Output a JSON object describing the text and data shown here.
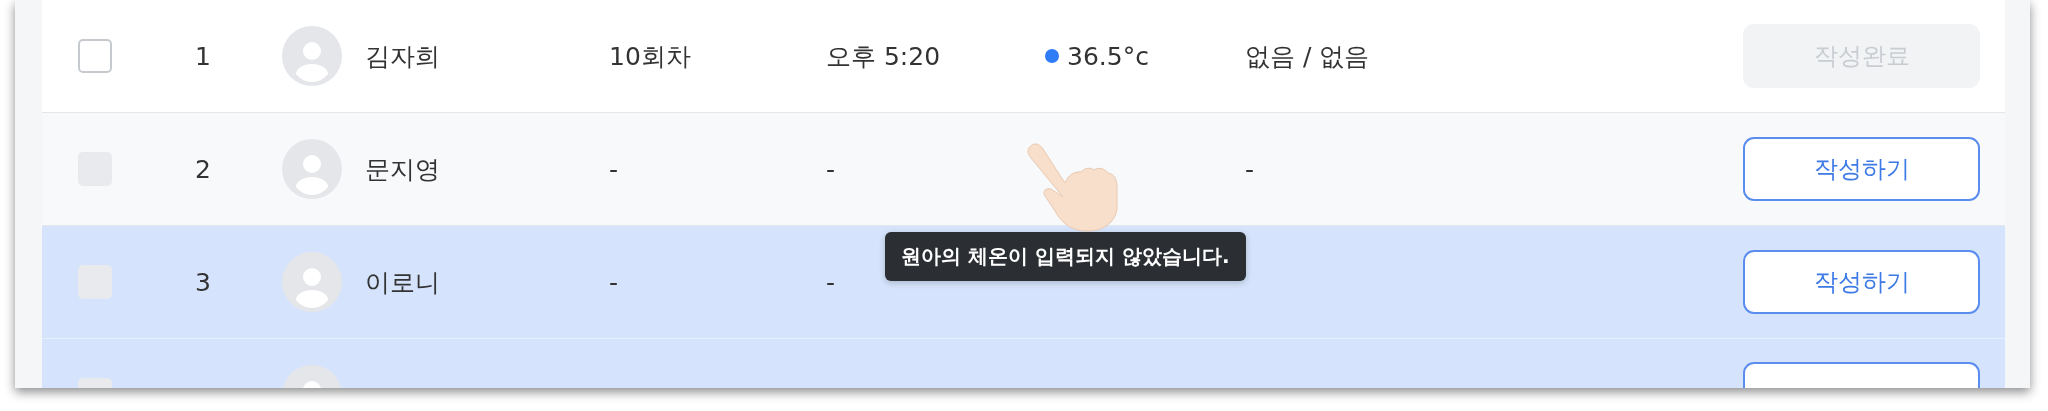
{
  "rows": [
    {
      "selected": false,
      "checkbox": {
        "checked": false,
        "disabled": false
      },
      "number": "1",
      "name": "김자희",
      "session": "10회차",
      "time": "오후 5:20",
      "temperature": {
        "text": "36.5°c",
        "color": "#2f7cf6"
      },
      "allergy": "없음 / 없음",
      "action": {
        "label": "작성완료",
        "disabled": true
      }
    },
    {
      "selected": false,
      "checkbox": {
        "checked": false,
        "disabled": true
      },
      "number": "2",
      "name": "문지영",
      "session": "-",
      "time": "-",
      "allergy": "-",
      "action": {
        "label": "작성하기",
        "disabled": false
      }
    },
    {
      "selected": true,
      "checkbox": {
        "checked": false,
        "disabled": true
      },
      "number": "3",
      "name": "이로니",
      "session": "-",
      "time": "-",
      "action": {
        "label": "작성하기",
        "disabled": false
      }
    },
    {
      "selected": true,
      "checkbox": {
        "checked": false,
        "disabled": true
      },
      "action": {
        "disabled": false
      }
    }
  ],
  "tooltip": {
    "text": "원아의 체온이 입력되지 않았습니다."
  }
}
